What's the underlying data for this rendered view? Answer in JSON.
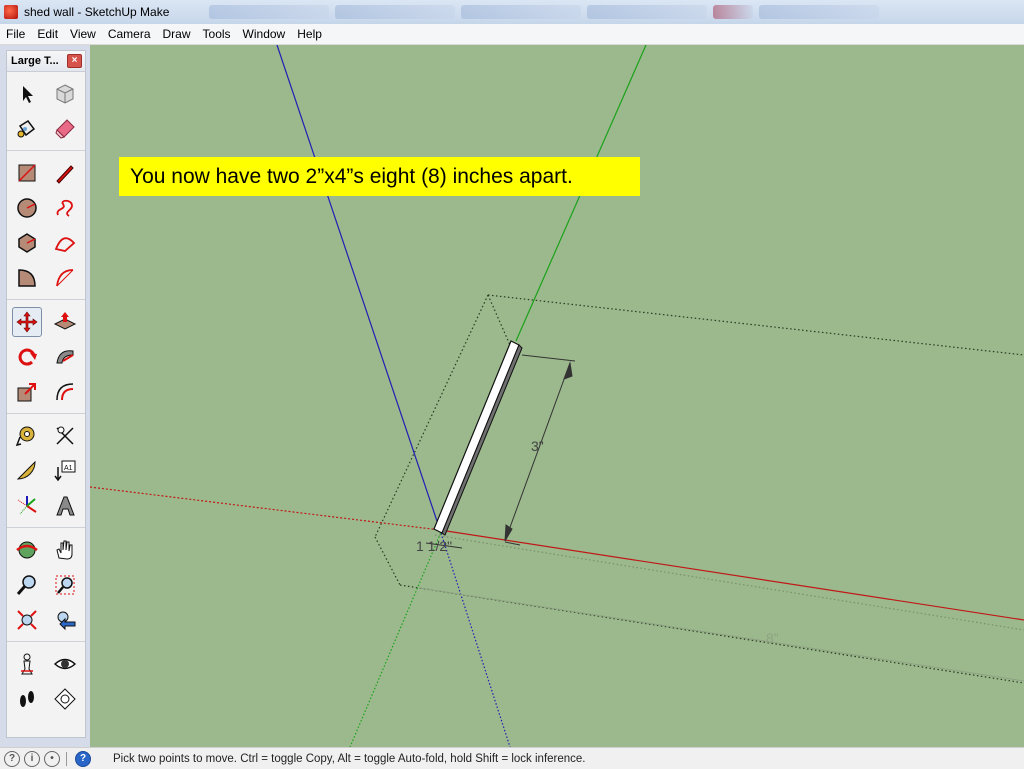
{
  "window": {
    "title": "shed wall - SketchUp Make"
  },
  "menu": {
    "items": [
      "File",
      "Edit",
      "View",
      "Camera",
      "Draw",
      "Tools",
      "Window",
      "Help"
    ]
  },
  "toolbar": {
    "title": "Large T...",
    "close_glyph": "×",
    "groups": [
      [
        "select-icon",
        "make-component-icon",
        "paint-bucket-icon",
        "eraser-icon"
      ],
      [
        "rectangle-icon",
        "line-icon",
        "circle-icon",
        "freehand-icon",
        "polygon-icon",
        "arc-icon",
        "pie-icon",
        "two-point-arc-icon"
      ],
      [
        "move-icon",
        "push-pull-icon",
        "rotate-icon",
        "follow-me-icon",
        "scale-icon",
        "offset-icon"
      ],
      [
        "tape-measure-icon",
        "dimension-icon",
        "protractor-icon",
        "text-icon",
        "axes-icon",
        "3d-text-icon"
      ],
      [
        "orbit-icon",
        "pan-icon",
        "zoom-icon",
        "zoom-window-icon",
        "zoom-extents-icon",
        "previous-view-icon"
      ],
      [
        "position-camera-icon",
        "look-around-icon",
        "walk-icon",
        "section-plane-icon"
      ]
    ],
    "active_tool": "move-icon"
  },
  "viewport": {
    "background": "#9bb98d",
    "callout": "You now have two 2”x4”s eight (8) inches apart.",
    "dimension_labels": {
      "vertical": "3\"",
      "short": "1 1/2\"",
      "long": "8\""
    },
    "axis_colors": {
      "red": "#c01818",
      "green": "#1aa21a",
      "blue": "#1f1fb4"
    }
  },
  "statusbar": {
    "icons": [
      "geo-location-icon",
      "credits-icon",
      "user-icon",
      "help-icon"
    ],
    "message": "Pick two points to move.  Ctrl = toggle Copy, Alt = toggle Auto-fold, hold Shift = lock inference."
  }
}
